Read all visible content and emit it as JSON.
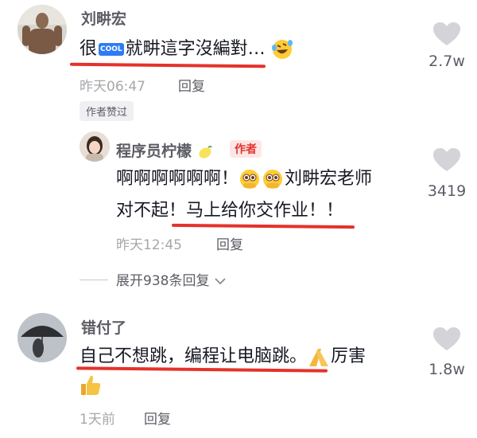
{
  "comments": [
    {
      "author": "刘畊宏",
      "text_before_badge": "很",
      "badge": "COOL",
      "text_after_badge": "就畊這字沒編對…",
      "emoji_icon": "laughing-tears-emoji-icon",
      "time": "昨天06:47",
      "reply_label": "回复",
      "liked_tag": "作者赞过",
      "likes": "2.7w"
    },
    {
      "author": "程序员柠檬",
      "name_emoji_icon": "lemon-emoji-icon",
      "author_tag": "作者",
      "line1_before": "啊啊啊啊啊啊！",
      "line1_emoji_icon": "pleading-emoji-icon",
      "line1_after": "刘畊宏老师",
      "line2": "对不起！马上给你交作业！！",
      "time": "昨天12:45",
      "reply_label": "回复",
      "likes": "3419"
    },
    {
      "author": "错付了",
      "line1": "自己不想跳，编程让电脑跳。",
      "line1_emoji_icon": "hands-emoji-icon",
      "line1_after": "厉害",
      "line2_emoji_icon": "thumbs-up-emoji-icon",
      "time": "1天前",
      "reply_label": "回复",
      "likes": "1.8w"
    }
  ],
  "expand_replies": "展开938条回复",
  "colors": {
    "underline": "#e4322b",
    "heart": "#d4d4d8",
    "author_tag_bg": "#fde6e5"
  }
}
